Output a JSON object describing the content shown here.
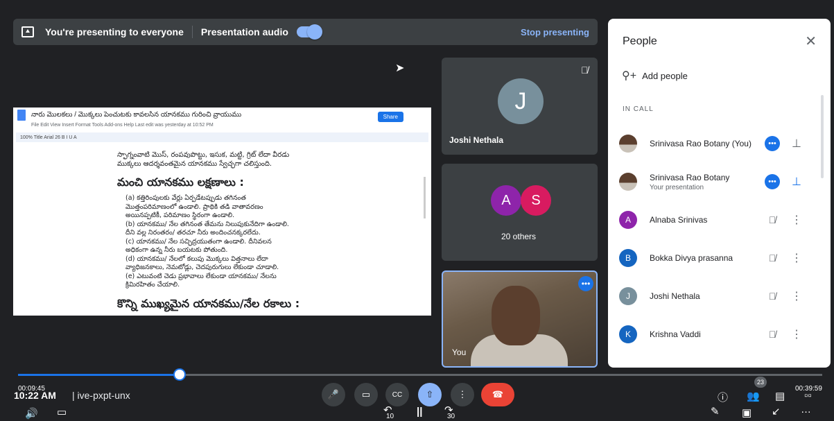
{
  "present_bar": {
    "text": "You're presenting to everyone",
    "audio_label": "Presentation audio",
    "audio_on": true,
    "stop_label": "Stop presenting"
  },
  "doc": {
    "title": "నారు మొలకలు / మొక్కలు పెంచుటకు కావలసిన యానకము గురించి వ్రాయుము",
    "menu": "File  Edit  View  Insert  Format  Tools  Add-ons  Help   Last edit was yesterday at 10:52 PM",
    "toolbar": "100%  Title  Arial  26  B  I  U  A",
    "share": "Share",
    "line1": "స్ఫాగ్నంవాటి మొస్, రంపవుపొట్టు, ఇసుక, మట్టి, గ్రిట్ లేదా వీరడు",
    "line2": "ముక్కలు ఆదర్శవంతమైన యానకము స్వేచ్ఛగా చలిస్తుంది.",
    "heading1": "మంచి యానకము లక్షణాలు :",
    "items": [
      "(a)  కత్తిరింపులకు వేర్లు ఏర్పడేటప్పుడు తగినంత",
      "      మొత్తంపరిమాణంలో ఉండాలి. ప్రాథికి తడి వాతావరణం",
      "      అయినప్పటికీ, పరిమాణం స్థిరంగా ఉండాలి.",
      "(b)  యానకము/ నేల తగినంత తేమను నిలుపుకునేదిగా ఉండాలి.",
      "      దీని వల్ల నిరంతరం/ తరచూ నీరు అందించనక్కరలేదు.",
      "(c)  యానకము/ నేల సచ్ఛిద్రయుతంగా ఉండాలి. దీనివలన",
      "      అధికంగా ఉన్న నీరు బయటకు పోతుంది.",
      "(d)  యానకము/ నేలలో కలుపు మొక్కలు విత్తనాలు లేదా",
      "      వ్యాధిజనకాలు, నెమటోడ్లు, చెదపురుగులు లేకుండా చూడాలి.",
      "(e)  ఎటువంటి చెడు ప్రభావాలు లేకుండా యానకము/ నేలను",
      "      క్రిమిరహితం చేయాలి."
    ],
    "heading2": "కొన్ని ముఖ్యమైన యానకము/నేల రకాలు :"
  },
  "tiles": {
    "joshi": {
      "initial": "J",
      "name": "Joshi Nethala"
    },
    "others": {
      "a": "A",
      "s": "S",
      "label": "20 others"
    },
    "you": {
      "label": "You"
    }
  },
  "people": {
    "title": "People",
    "add_label": "Add people",
    "in_call": "IN CALL",
    "list": [
      {
        "name": "Srinivasa Rao Botany (You)",
        "sub": ""
      },
      {
        "name": "Srinivasa Rao Botany",
        "sub": "Your presentation"
      },
      {
        "initial": "A",
        "name": "Alnaba Srinivas",
        "color": "#8e24aa"
      },
      {
        "initial": "B",
        "name": "Bokka Divya prasanna",
        "color": "#1565c0"
      },
      {
        "initial": "J",
        "name": "Joshi Nethala",
        "color": "#78909c"
      },
      {
        "initial": "K",
        "name": "Krishna Vaddi",
        "color": "#1565c0"
      }
    ]
  },
  "player": {
    "elapsed": "00:09:45",
    "total": "00:39:59",
    "progress": 0.244,
    "clock": "10:22 AM",
    "meeting_code": "ive-pxpt-unx",
    "skip_back": "10",
    "skip_fwd": "30",
    "people_count": "23"
  },
  "colors": {
    "accent": "#1a73e8",
    "end_call": "#ea4335",
    "avatar_a": "#8e24aa",
    "avatar_s": "#d81b60"
  }
}
